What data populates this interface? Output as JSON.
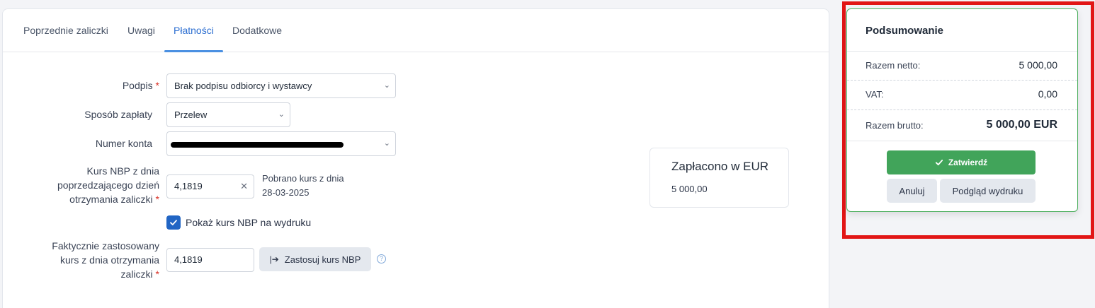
{
  "tabs": [
    {
      "label": "Poprzednie zaliczki"
    },
    {
      "label": "Uwagi"
    },
    {
      "label": "Płatności"
    },
    {
      "label": "Dodatkowe"
    }
  ],
  "active_tab": "Płatności",
  "form": {
    "podpis": {
      "label": "Podpis",
      "value": "Brak podpisu odbiorcy i wystawcy"
    },
    "sposob": {
      "label": "Sposób zapłaty",
      "value": "Przelew"
    },
    "numer_konta": {
      "label": "Numer konta",
      "value": ""
    },
    "kurs_nbp": {
      "label_lines": [
        "Kurs NBP z dnia",
        "poprzedzającego dzień",
        "otrzymania zaliczki"
      ],
      "value": "4,1819",
      "note_lines": [
        "Pobrano kurs z dnia",
        "28-03-2025"
      ]
    },
    "pokaz_checkbox": {
      "label": "Pokaż kurs NBP na wydruku",
      "checked": true
    },
    "faktycznie": {
      "label_lines": [
        "Faktycznie zastosowany",
        "kurs z dnia otrzymania",
        "zaliczki"
      ],
      "value": "4,1819",
      "apply_label": "Zastosuj kurs NBP"
    }
  },
  "paid": {
    "title": "Zapłacono w EUR",
    "value": "5 000,00"
  },
  "summary": {
    "title": "Podsumowanie",
    "netto_label": "Razem netto:",
    "netto_value": "5 000,00",
    "vat_label": "VAT:",
    "vat_value": "0,00",
    "brutto_label": "Razem brutto:",
    "brutto_value": "5 000,00 EUR",
    "confirm_label": "Zatwierdź",
    "cancel_label": "Anuluj",
    "preview_label": "Podgląd wydruku"
  },
  "colors": {
    "accent": "#4a90e2",
    "confirm": "#41a45a",
    "highlight": "#e21616",
    "checkbox": "#2165c4"
  }
}
